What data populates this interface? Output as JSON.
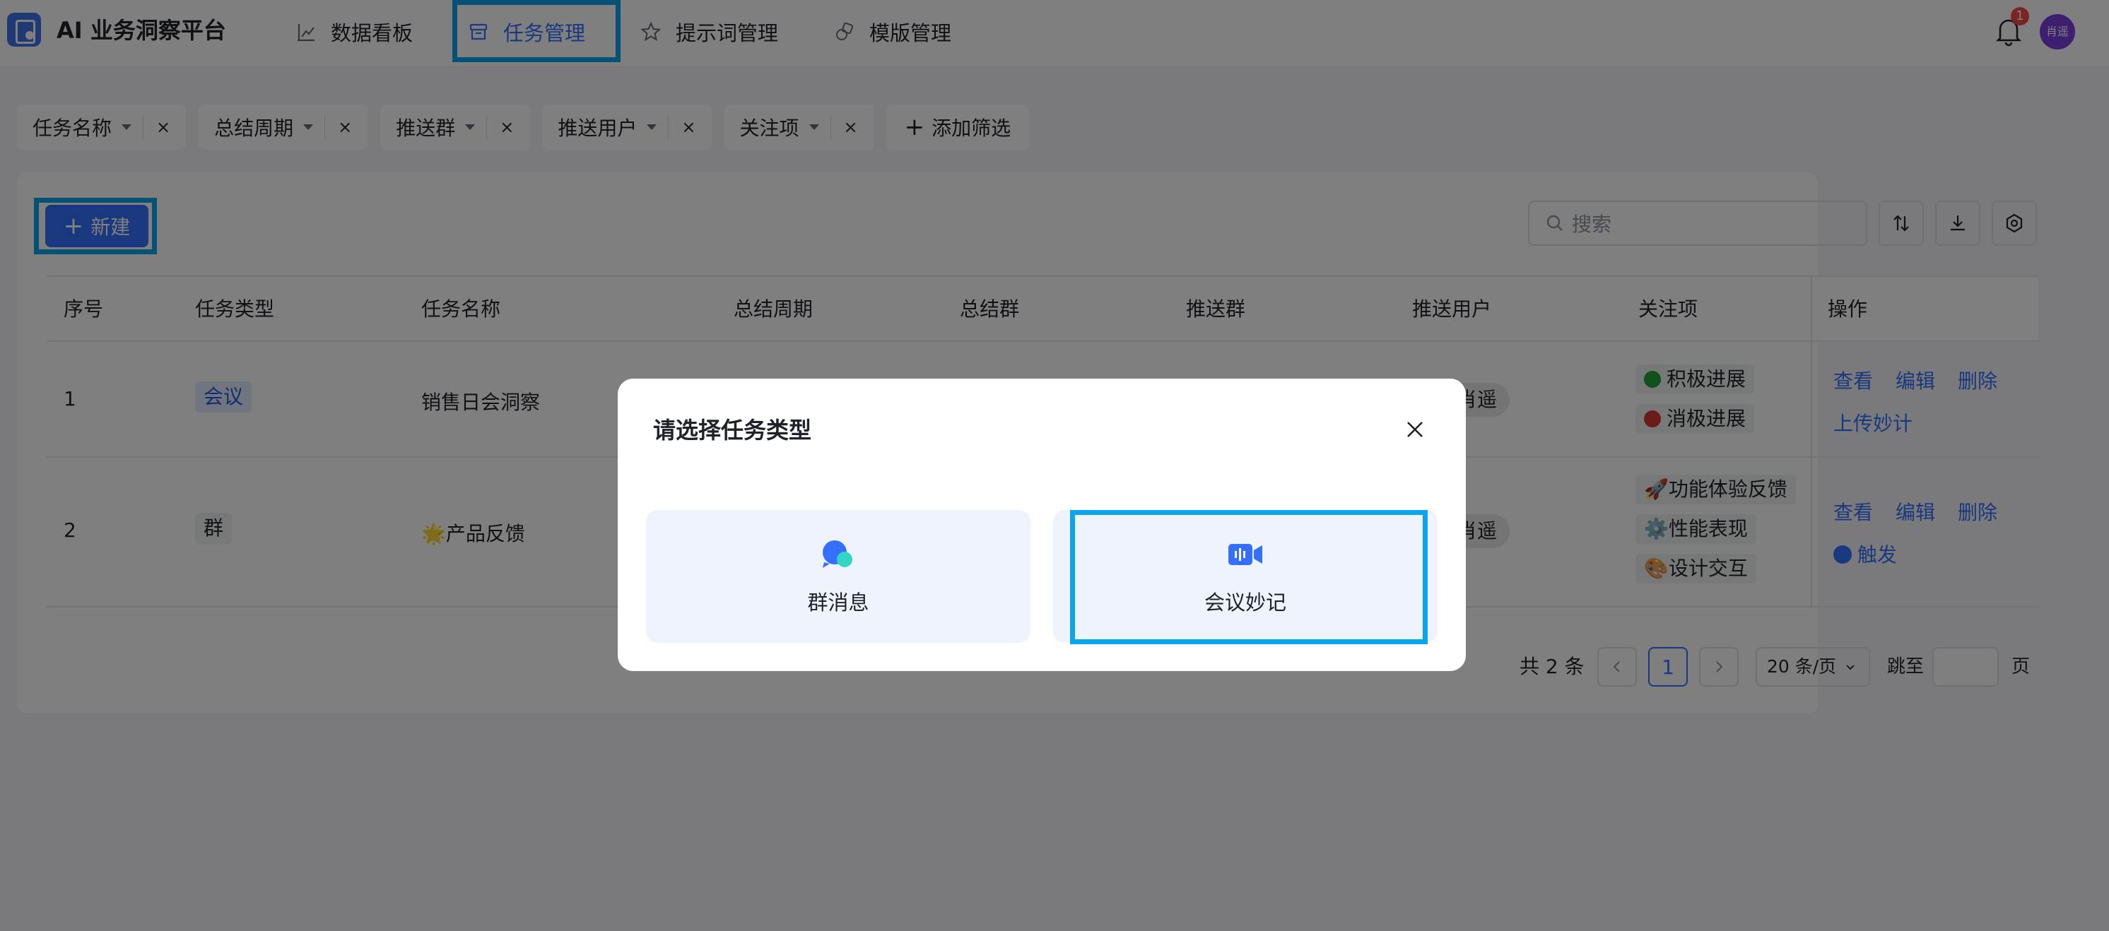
{
  "app": {
    "title": "AI 业务洞察平台"
  },
  "nav": [
    {
      "label": "数据看板",
      "icon": "chart-icon"
    },
    {
      "label": "任务管理",
      "icon": "archive-icon",
      "active": true
    },
    {
      "label": "提示词管理",
      "icon": "star-icon"
    },
    {
      "label": "模版管理",
      "icon": "template-icon"
    }
  ],
  "header": {
    "notification_count": "1",
    "avatar_text": "肖遥"
  },
  "filters": [
    {
      "label": "任务名称"
    },
    {
      "label": "总结周期"
    },
    {
      "label": "推送群"
    },
    {
      "label": "推送用户"
    },
    {
      "label": "关注项"
    }
  ],
  "filter_add_label": "添加筛选",
  "filter_clear_glyph": "×",
  "toolbar": {
    "new_label": "新建",
    "search_placeholder": "搜索"
  },
  "table": {
    "columns": [
      "序号",
      "任务类型",
      "任务名称",
      "总结周期",
      "总结群",
      "推送群",
      "推送用户",
      "关注项",
      "操作"
    ],
    "rows": [
      {
        "index": "1",
        "type": "会议",
        "name": "销售日会洞察",
        "push_user_visible": "肖遥",
        "focus": [
          {
            "label": "积极进展",
            "dot_color": "#22a33a"
          },
          {
            "label": "消极进展",
            "dot_color": "#d83931"
          }
        ],
        "actions": [
          "查看",
          "编辑",
          "删除",
          "上传妙计"
        ]
      },
      {
        "index": "2",
        "type": "群",
        "name": "🌟产品反馈",
        "push_user_visible": "肖遥",
        "focus": [
          {
            "label": "🚀功能体验反馈"
          },
          {
            "label": "⚙️性能表现"
          },
          {
            "label": "🎨设计交互"
          }
        ],
        "actions": [
          "查看",
          "编辑",
          "删除",
          "触发"
        ]
      }
    ]
  },
  "pagination": {
    "total": "共 2 条",
    "current_page": "1",
    "page_size": "20 条/页",
    "jump_label": "跳至",
    "page_label": "页"
  },
  "modal": {
    "title": "请选择任务类型",
    "options": [
      {
        "label": "群消息",
        "icon": "chat-bubbles-icon"
      },
      {
        "label": "会议妙记",
        "icon": "meeting-video-icon"
      }
    ]
  },
  "colors": {
    "accent": "#3370ff",
    "highlight_box": "#0aa5ec",
    "tag_blue_bg": "#e1eaff",
    "overlay": "rgba(0,0,0,0.5)"
  }
}
